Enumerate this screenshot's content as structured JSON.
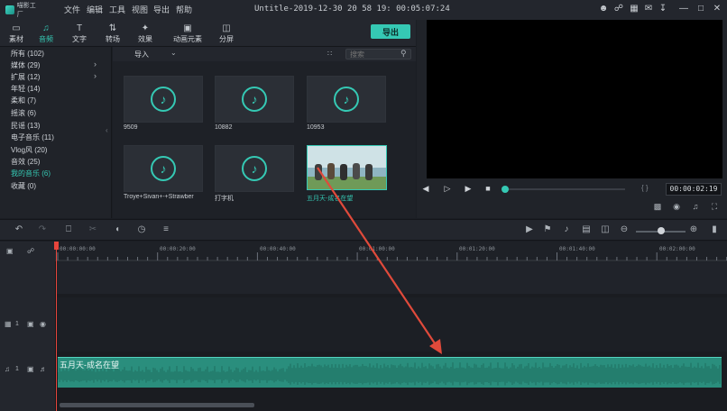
{
  "app": {
    "logo_text": "喵影工厂",
    "window_title": "Untitle-2019-12-30 20 58 19: 00:05:07:24"
  },
  "menu": [
    "文件",
    "编辑",
    "工具",
    "视图",
    "导出",
    "帮助"
  ],
  "tabs": [
    {
      "label": "素材",
      "icon": "folder-icon"
    },
    {
      "label": "音频",
      "icon": "music-note-icon"
    },
    {
      "label": "文字",
      "icon": "text-icon"
    },
    {
      "label": "转场",
      "icon": "transition-icon"
    },
    {
      "label": "效果",
      "icon": "effects-icon"
    },
    {
      "label": "动画元素",
      "icon": "image-icon"
    },
    {
      "label": "分屏",
      "icon": "split-screen-icon"
    }
  ],
  "export_label": "导出",
  "categories": [
    {
      "label": "所有 (102)"
    },
    {
      "label": "媒体 (29)"
    },
    {
      "label": "扩展 (12)"
    },
    {
      "label": "年轻 (14)"
    },
    {
      "label": "柔和 (7)"
    },
    {
      "label": "摇滚 (6)"
    },
    {
      "label": "民谣 (13)"
    },
    {
      "label": "电子音乐 (11)"
    },
    {
      "label": "Vlog风 (20)"
    },
    {
      "label": "音效 (25)"
    },
    {
      "label": "我的音乐 (6)"
    },
    {
      "label": "收藏 (0)"
    }
  ],
  "library": {
    "import_label": "导入",
    "search_placeholder": "搜索",
    "items": [
      {
        "label": "9509"
      },
      {
        "label": "10882"
      },
      {
        "label": "10953"
      },
      {
        "label": "Troye+Sivan+-+Strawber"
      },
      {
        "label": "打字机"
      },
      {
        "label": "五月天-成名在望"
      }
    ]
  },
  "preview": {
    "timecode": "00:00:02:19",
    "brace": "{  }"
  },
  "ruler": [
    "00:00:00:00",
    "00:00:20:00",
    "00:00:40:00",
    "00:01:00:00",
    "00:01:20:00",
    "00:01:40:00",
    "00:02:00:00"
  ],
  "tracks": {
    "video_index": "1",
    "audio_index": "1",
    "clip_label": "五月天-成名在望"
  },
  "colors": {
    "accent": "#35c9b4",
    "playhead": "#e8453c",
    "clip": "#2a8e7d",
    "annotation_arrow": "#e04a3b"
  }
}
